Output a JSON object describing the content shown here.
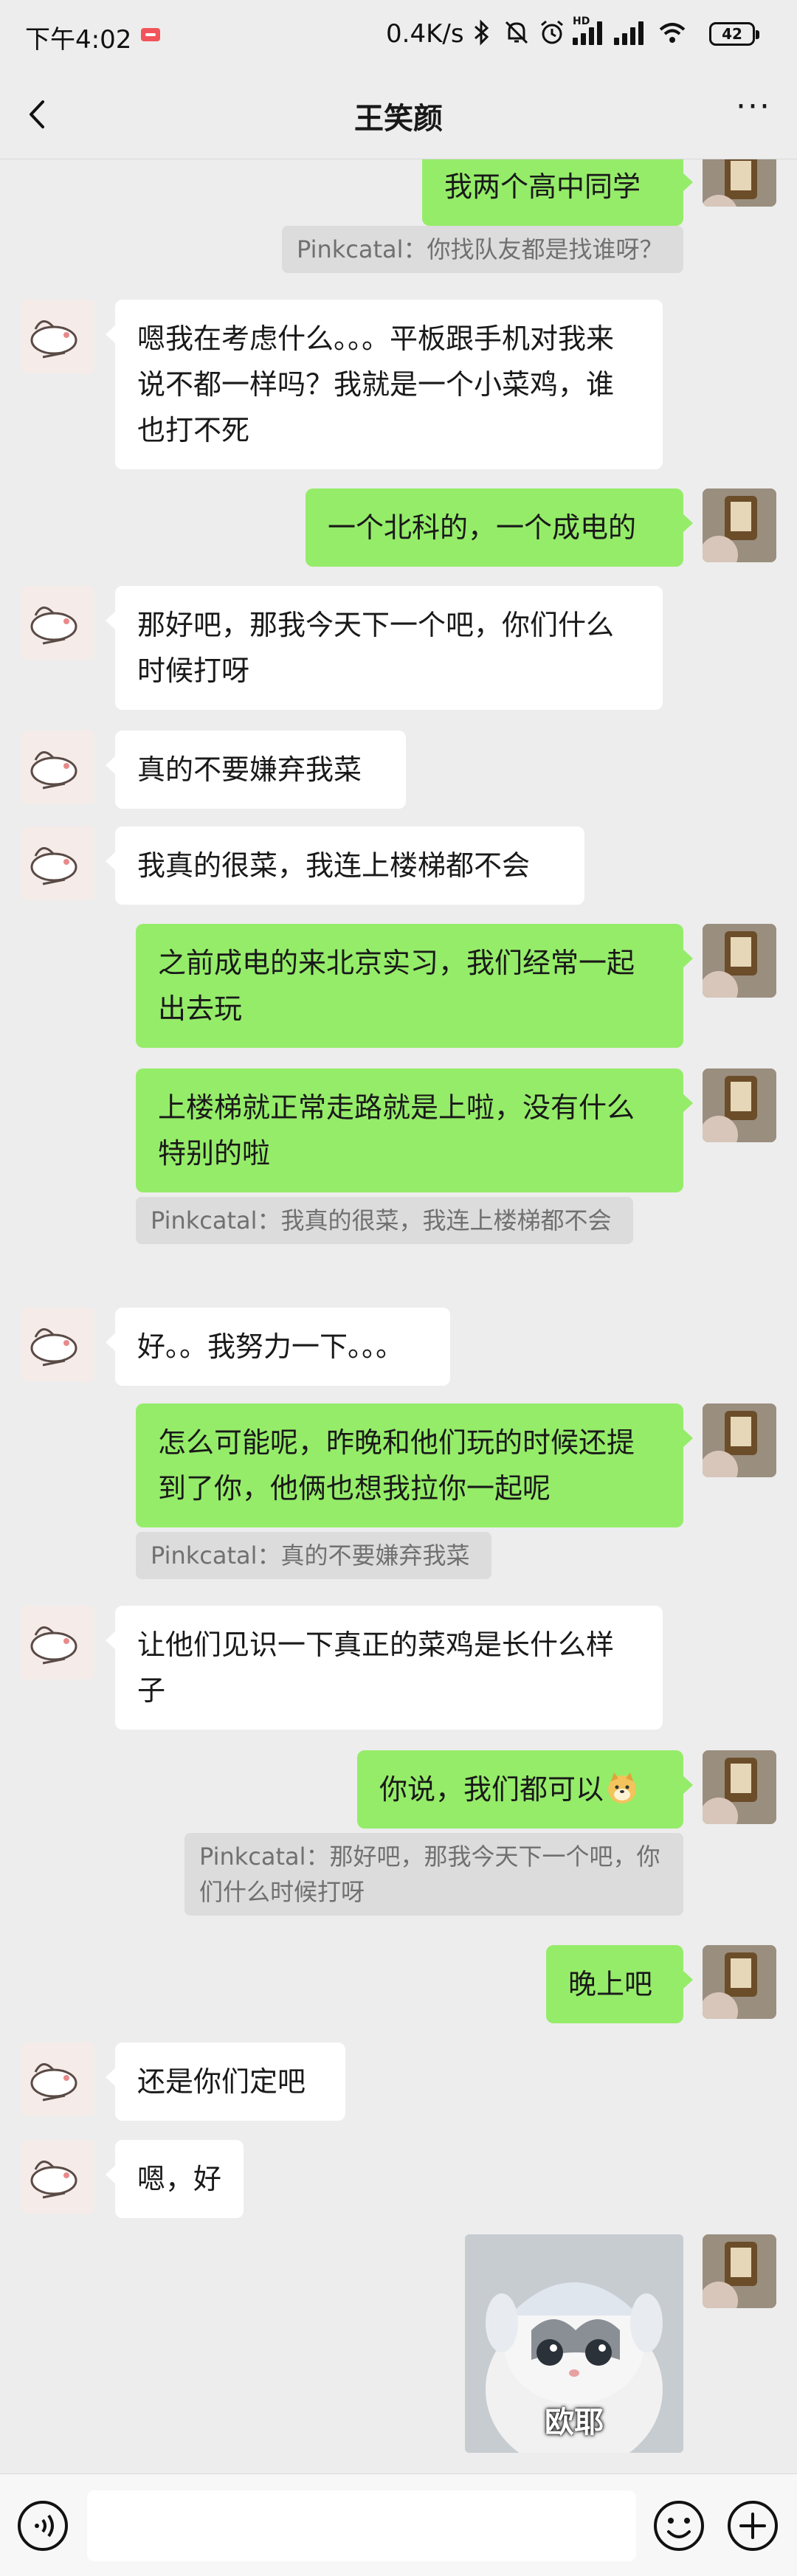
{
  "status_bar": {
    "time": "下午4:02",
    "net_speed": "0.4K/s",
    "battery": "42",
    "icons": [
      "screen-record-icon",
      "bluetooth-icon",
      "mute-bell-icon",
      "alarm-icon",
      "hd-signal-icon",
      "signal-icon",
      "wifi-icon",
      "battery-icon"
    ]
  },
  "header": {
    "title": "王笑颜",
    "more": "···"
  },
  "messages": [
    {
      "side": "right",
      "text": "我两个高中同学"
    },
    {
      "quote": "Pinkcatal：你找队友都是找谁呀？"
    },
    {
      "side": "left",
      "text": "嗯我在考虑什么。。。平板跟手机对我来说不都一样吗？我就是一个小菜鸡，谁也打不死"
    },
    {
      "side": "right",
      "text": "一个北科的，一个成电的"
    },
    {
      "side": "left",
      "text": "那好吧，那我今天下一个吧，你们什么时候打呀"
    },
    {
      "side": "left",
      "text": "真的不要嫌弃我菜"
    },
    {
      "side": "left",
      "text": "我真的很菜，我连上楼梯都不会"
    },
    {
      "side": "right",
      "text": "之前成电的来北京实习，我们经常一起出去玩"
    },
    {
      "side": "right",
      "text": "上楼梯就正常走路就是上啦，没有什么特别的啦"
    },
    {
      "quote": "Pinkcatal：我真的很菜，我连上楼梯都不会"
    },
    {
      "side": "left",
      "text": "好。。我努力一下。。。"
    },
    {
      "side": "right",
      "text": "怎么可能呢，昨晚和他们玩的时候还提到了你，他俩也想我拉你一起呢"
    },
    {
      "quote": "Pinkcatal：真的不要嫌弃我菜"
    },
    {
      "side": "left",
      "text": "让他们见识一下真正的菜鸡是长什么样子"
    },
    {
      "side": "right",
      "text": "你说，我们都可以",
      "emoji": "doge-emoji"
    },
    {
      "quote": "Pinkcatal：那好吧，那我今天下一个吧，你们什么时候打呀"
    },
    {
      "side": "right",
      "text": "晚上吧"
    },
    {
      "side": "left",
      "text": "还是你们定吧"
    },
    {
      "side": "left",
      "text": "嗯，好"
    },
    {
      "side": "right",
      "sticker_caption": "欧耶"
    }
  ],
  "input_bar": {
    "icons": [
      "voice-icon",
      "emoji-icon",
      "plus-icon"
    ]
  },
  "colors": {
    "background": "#ededed",
    "bubble_sent": "#95ec69",
    "bubble_received": "#ffffff",
    "quote_bg": "#dcdcdc"
  }
}
